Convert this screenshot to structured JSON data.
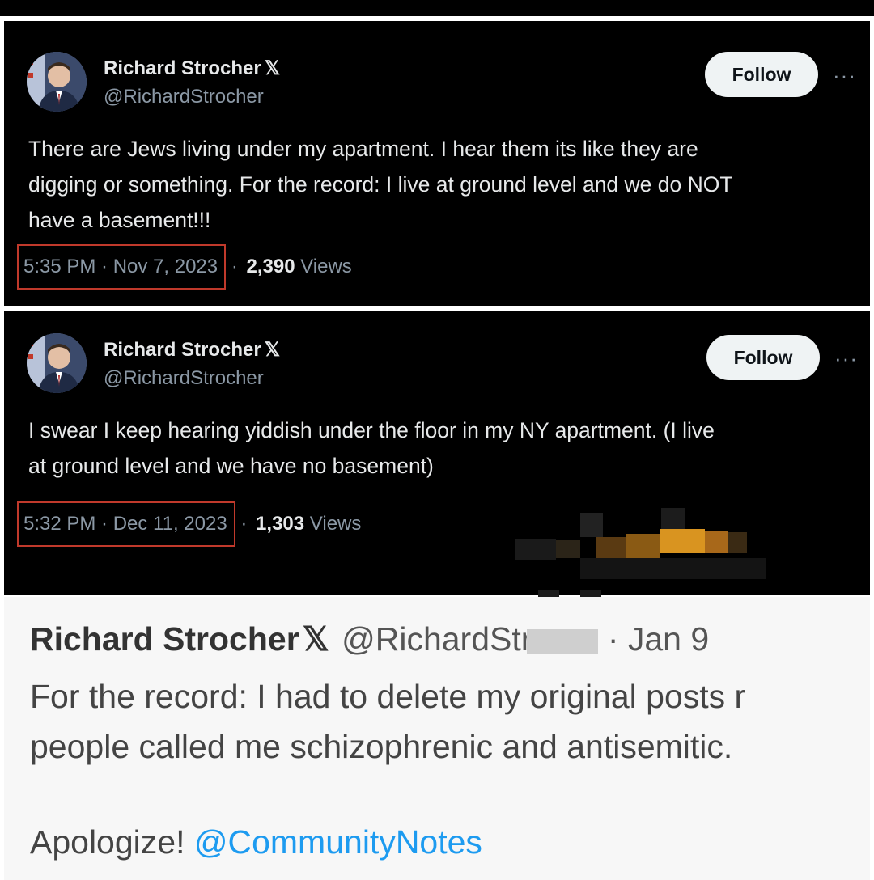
{
  "tweets": [
    {
      "author_name": "Richard Strocher",
      "verified_mark": "𝕏",
      "handle": "@RichardStrocher",
      "follow_label": "Follow",
      "more_label": "···",
      "text_lines": [
        "There are Jews living under my apartment. I hear them its like they are",
        "digging or something. For the record: I live at ground level and we do NOT",
        "have a basement!!!"
      ],
      "timestamp": "5:35 PM · Nov 7, 2023",
      "separator": "·",
      "views_count": "2,390",
      "views_label": "Views"
    },
    {
      "author_name": "Richard Strocher",
      "verified_mark": "𝕏",
      "handle": "@RichardStrocher",
      "follow_label": "Follow",
      "more_label": "···",
      "text_lines": [
        "I swear I keep hearing yiddish under the floor in my NY apartment. (I live",
        "at ground level and we have no basement)"
      ],
      "timestamp": "5:32 PM · Dec 11, 2023",
      "separator": "·",
      "views_count": "1,303",
      "views_label": "Views"
    }
  ],
  "reply": {
    "author_name": "Richard Strocher",
    "verified_mark": "𝕏",
    "handle_visible": "@RichardStr",
    "date": "· Jan 9",
    "line1": "For the record: I had to delete my original posts r",
    "line2": "people called me schizophrenic and antisemitic.",
    "line3_text": "Apologize!",
    "line3_mention": "@CommunityNotes"
  },
  "colors": {
    "dark_bg": "#000000",
    "light_bg": "#f7f7f7",
    "link": "#1d9bf0",
    "highlight_box": "#c0392b"
  }
}
